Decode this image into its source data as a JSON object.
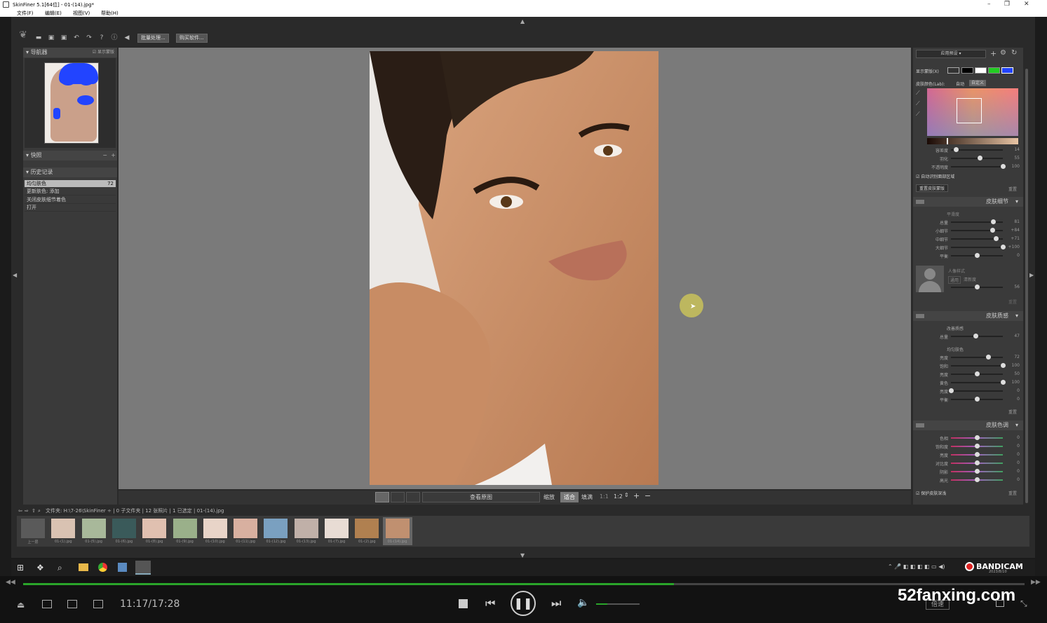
{
  "window": {
    "title": "SkinFiner 5.1[64位] - 01-(14).jpg*",
    "menu": [
      "文件(F)",
      "编辑(E)",
      "视图(V)",
      "帮助(H)"
    ]
  },
  "toolbar": {
    "batch_button": "批量处理...",
    "buy_button": "购买软件..."
  },
  "left_panel": {
    "navigator_title": "导航器",
    "navigator_checkbox": "显示蒙版",
    "snapshot_title": "快照",
    "history_title": "历史记录",
    "history_items": [
      {
        "label": "均匀肤色",
        "value": "72"
      },
      {
        "label": "更新肤色: 添加",
        "value": ""
      },
      {
        "label": "关闭皮肤细节着色",
        "value": ""
      },
      {
        "label": "打开",
        "value": ""
      }
    ]
  },
  "view_bar": {
    "view_original": "查看原图",
    "zoom_label": "缩放",
    "fit_button": "适合",
    "fill_button": "填满",
    "ratio_1": "1:1",
    "ratio_2": "1:2"
  },
  "right_panel": {
    "preset_dropdown": "应用预设",
    "mask_color_label": "显示蒙版(X)",
    "skin_color_label": "皮肤颜色(Lab):",
    "skin_color_auto": "自动",
    "skin_color_custom": "自定义",
    "skin_tone_colors": [
      "#1a0a05",
      "#e8c4a4"
    ],
    "mask_swatch_colors": [
      "#000000",
      "#ffffff",
      "#22cc22",
      "#2244ff"
    ],
    "mask_sliders": [
      {
        "label": "容差度",
        "value": 14,
        "pos": 0.1
      },
      {
        "label": "羽化",
        "value": 55,
        "pos": 0.55
      },
      {
        "label": "不透明度",
        "value": 100,
        "pos": 1.0
      }
    ],
    "auto_update_checkbox": "自动识别面部区域",
    "reset_skin_button": "重置皮肤蒙版",
    "reset_label": "重置",
    "detail_title": "皮肤细节",
    "detail_sub": "平滑度",
    "detail_sliders": [
      {
        "label": "总量",
        "value": "81",
        "pos": 0.81
      },
      {
        "label": "小细节",
        "value": "+84",
        "pos": 0.8
      },
      {
        "label": "中细节",
        "value": "+71",
        "pos": 0.86
      },
      {
        "label": "大细节",
        "value": "+100",
        "pos": 1.0
      },
      {
        "label": "平衡",
        "value": "0",
        "pos": 0.5
      }
    ],
    "portrait_label": "人像样式",
    "portrait_buttons": [
      "通用",
      "清新度"
    ],
    "portrait_value": "56",
    "portrait_pos": 0.5,
    "texture_title": "皮肤质感",
    "texture_sub1": "改善质感",
    "texture_sliders1": [
      {
        "label": "总量",
        "value": "47",
        "pos": 0.47
      }
    ],
    "texture_sub2": "均匀肤色",
    "texture_sliders2": [
      {
        "label": "亮度",
        "value": "72",
        "pos": 0.72
      },
      {
        "label": "饱和",
        "value": "100",
        "pos": 1.0
      },
      {
        "label": "亮度",
        "value": "50",
        "pos": 0.5
      },
      {
        "label": "黄色",
        "value": "100",
        "pos": 1.0
      },
      {
        "label": "亮度",
        "value": "0",
        "pos": 0.0
      },
      {
        "label": "平衡",
        "value": "0",
        "pos": 0.5
      }
    ],
    "tone_title": "皮肤色调",
    "tone_sliders": [
      {
        "label": "色相",
        "value": "0",
        "pos": 0.5
      },
      {
        "label": "饱和度",
        "value": "0",
        "pos": 0.5
      },
      {
        "label": "亮度",
        "value": "0",
        "pos": 0.5
      },
      {
        "label": "对比度",
        "value": "0",
        "pos": 0.5
      },
      {
        "label": "阴影",
        "value": "0",
        "pos": 0.5
      },
      {
        "label": "高光",
        "value": "0",
        "pos": 0.5
      }
    ],
    "protect_checkbox": "保护皮肤深浅"
  },
  "film_path": "文件夹: H:\\7-26\\SkinFiner ÷ | 0 子文件夹 | 12 张照片 | 1 已选定 | 01-(14).jpg",
  "thumbnails": [
    {
      "label": "上一层",
      "color": "#5a5a5a"
    },
    {
      "label": "01-(1).jpg",
      "color": "#d9c2b2"
    },
    {
      "label": "01-(5).jpg",
      "color": "#a8b89a"
    },
    {
      "label": "01-(6).jpg",
      "color": "#3a5a5a"
    },
    {
      "label": "01-(8).jpg",
      "color": "#e0c0b0"
    },
    {
      "label": "01-(9).jpg",
      "color": "#9ab08a"
    },
    {
      "label": "01-(10).jpg",
      "color": "#e8d4c8"
    },
    {
      "label": "01-(11).jpg",
      "color": "#d8b0a0"
    },
    {
      "label": "01-(12).jpg",
      "color": "#7aa0c0"
    },
    {
      "label": "01-(13).jpg",
      "color": "#c0b0a8"
    },
    {
      "label": "01-(7).jpg",
      "color": "#e8dcd4"
    },
    {
      "label": "01-(2).jpg",
      "color": "#b08050"
    },
    {
      "label": "01-(14).jpg",
      "color": "#c09070"
    }
  ],
  "tray": {
    "recorder": "BANDICAM",
    "date": "2023/8/10"
  },
  "player": {
    "time": "11:17/17:28",
    "progress": 0.65,
    "volume": 0.25,
    "speed_button": "倍速",
    "watermark": "52fanxing.com"
  }
}
